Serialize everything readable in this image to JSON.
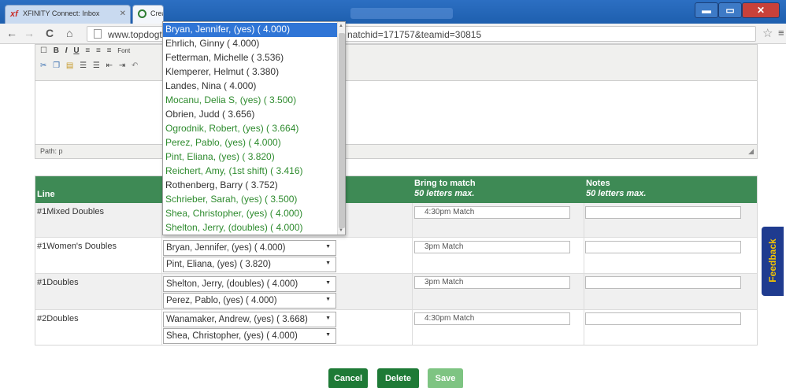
{
  "browser": {
    "tabs": [
      {
        "label": "XFINITY Connect: Inbox"
      },
      {
        "label": "Crea"
      }
    ],
    "url_start": "www.topdogte",
    "url_end": "natchid=171757&teamid=30815"
  },
  "editor": {
    "toolbar_font_label": "Font",
    "path_label": "Path: p"
  },
  "table": {
    "headers": {
      "line": "Line",
      "bring": "Bring to match",
      "bring_sub": "50 letters max.",
      "notes": "Notes",
      "notes_sub": "50 letters max."
    },
    "rows": [
      {
        "line": "#1Mixed Doubles",
        "players": [],
        "bring": "4:30pm Match",
        "notes": ""
      },
      {
        "line": "#1Women's Doubles",
        "players": [
          "Bryan, Jennifer, (yes) ( 4.000)",
          "Pint, Eliana, (yes) ( 3.820)"
        ],
        "bring": "3pm Match",
        "notes": ""
      },
      {
        "line": "#1Doubles",
        "players": [
          "Shelton, Jerry, (doubles) ( 4.000)",
          "Perez, Pablo, (yes) ( 4.000)"
        ],
        "bring": "3pm Match",
        "notes": ""
      },
      {
        "line": "#2Doubles",
        "players": [
          "Wanamaker, Andrew, (yes) ( 3.668)",
          "Shea, Christopher, (yes) ( 4.000)"
        ],
        "bring": "4:30pm Match",
        "notes": ""
      }
    ]
  },
  "dropdown": {
    "items": [
      {
        "label": "Bryan, Jennifer, (yes) ( 4.000)",
        "style": "selected"
      },
      {
        "label": "Ehrlich, Ginny ( 4.000)",
        "style": "normal"
      },
      {
        "label": "Fetterman, Michelle ( 3.536)",
        "style": "normal"
      },
      {
        "label": "Klemperer, Helmut ( 3.380)",
        "style": "normal"
      },
      {
        "label": "Landes, Nina ( 4.000)",
        "style": "normal"
      },
      {
        "label": "Mocanu, Delia S, (yes) ( 3.500)",
        "style": "green"
      },
      {
        "label": "Obrien, Judd ( 3.656)",
        "style": "normal"
      },
      {
        "label": "Ogrodnik, Robert, (yes) ( 3.664)",
        "style": "green"
      },
      {
        "label": "Perez, Pablo, (yes) ( 4.000)",
        "style": "green"
      },
      {
        "label": "Pint, Eliana, (yes) ( 3.820)",
        "style": "green"
      },
      {
        "label": "Reichert, Amy, (1st shift) ( 3.416)",
        "style": "green"
      },
      {
        "label": "Rothenberg, Barry ( 3.752)",
        "style": "normal"
      },
      {
        "label": "Schrieber, Sarah, (yes) ( 3.500)",
        "style": "green"
      },
      {
        "label": "Shea, Christopher, (yes) ( 4.000)",
        "style": "green"
      },
      {
        "label": "Shelton, Jerry, (doubles) ( 4.000)",
        "style": "green"
      }
    ]
  },
  "buttons": {
    "cancel": "Cancel",
    "delete": "Delete",
    "save": "Save"
  },
  "feedback_label": "Feedback",
  "colors": {
    "header_green": "#3e8a55",
    "button_green": "#1e7a36",
    "save_disabled": "#7ec482",
    "player_green": "#2e8b2e",
    "selected_blue": "#2f75d6",
    "feedback_bg": "#1f3b8f",
    "feedback_text": "#f5c400"
  },
  "icons": {
    "back": "back-arrow-icon",
    "forward": "forward-arrow-icon",
    "reload": "reload-icon",
    "home": "home-icon",
    "bookmark": "star-icon",
    "menu": "menu-icon"
  }
}
